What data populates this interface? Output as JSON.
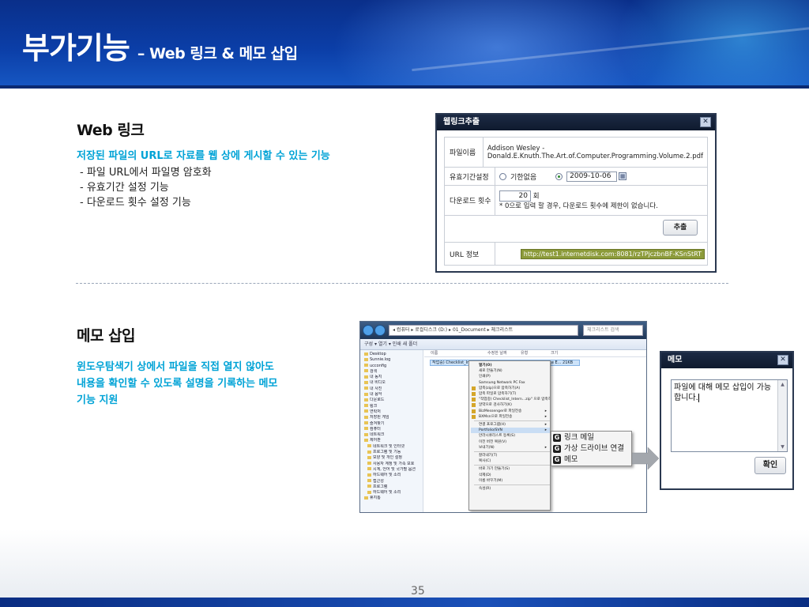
{
  "header": {
    "title_big": "부가기능",
    "title_sub": "– Web 링크 & 메모 삽입"
  },
  "web_link": {
    "title": "Web 링크",
    "lead": "저장된 파일의 URL로 자료를 웹 상에 게시할 수 있는 기능",
    "items": [
      "- 파일 URL에서 파일명 암호화",
      "- 유효기간 설정 기능",
      "- 다운로드 횟수 설정 기능"
    ]
  },
  "web_dialog": {
    "title": "웹링크추출",
    "close": "✕",
    "filename_label": "파일이름",
    "filename_value_1": "Addison Wesley -",
    "filename_value_2": "Donald.E.Knuth.The.Art.of.Computer.Programming.Volume.2.pdf",
    "expiry_label": "유효기간설정",
    "expiry_option_none": "기한없음",
    "expiry_date": "2009-10-06",
    "download_label": "다운로드 횟수",
    "download_count": "20",
    "download_unit": "회",
    "download_note": "* 0으로 입력 할 경우, 다운로드 횟수에 제한이 없습니다.",
    "extract_button": "추출",
    "url_label": "URL 정보",
    "url_value": "http://test1.internetdisk.com:8081/rzTPjczbnBF-KSnStRT"
  },
  "memo_section": {
    "title": "메모 삽입",
    "lead_lines": [
      "윈도우탐색기 상에서 파일을 직접 열지 않아도",
      "내용을 확인할 수 있도록 설명을 기록하는 메모",
      "기능 지원"
    ]
  },
  "explorer": {
    "address": "◂ 컴퓨터 ▸ 로컬디스크 (D:) ▸ 01_Document ▸ 체크리스트",
    "search": "체크리스트 검색",
    "toolbar": "구성 ▾    열기 ▾    인쇄    새 폴더",
    "columns": [
      "이름",
      "수정한 날짜",
      "유형",
      "크기"
    ],
    "file": "작업중) Checklist_Internet...  2010-01-05 오후...  Microsoft Office E...  21KB",
    "sidebar": [
      "Desktop",
      "Sunnie.log",
      "ucconfig",
      "검색",
      "내 동지",
      "내 비디오",
      "내 사진",
      "내 음악",
      "다운로드",
      "링크",
      "연락처",
      "저장된 게임",
      "즐겨찾기",
      "컴퓨터",
      "네트워크",
      "제어판",
      "네트워크 및 인터넷",
      "프로그램 및 기능",
      "모양 및 개인 설정",
      "사용자 계정 및 가족 보호",
      "시계, 언어 및 국가별 옵션",
      "하드웨어 및 소리",
      "접근성",
      "프로그램",
      "하드웨어 및 소리",
      "휴지통"
    ],
    "context_menu": [
      "열기(O)",
      "새로 만들기(N)",
      "인쇄(P)",
      "Samsung Network PC Fax",
      "압축(zip)으로 압축하기(A)",
      "압축 파일로 압축하기(T)",
      "\"작업중) Checklist_Intern...zip\" 으로 압축하기(Q)",
      "알약으로 검사하기(K)",
      "BizMessenger로 파일전송",
      "BXMsn으로 파일전송",
      "연결 프로그램(H)",
      "Portfolio/SVN",
      "이전 버전 복원(V)",
      "보내기(N)",
      "잘라내기(T)",
      "복사(C)",
      "바로 가기 만들기(S)",
      "삭제(D)",
      "이름 바꾸기(M)",
      "속성(R)"
    ],
    "security_item": "안라시큐리스트 등록(S)"
  },
  "submenu": {
    "items": [
      "링크 메일",
      "가상 드라이브 연결",
      "메모"
    ]
  },
  "memo_dialog": {
    "title": "메모",
    "close": "✕",
    "text_line1": "파일에 대해 메모 삽입이 가능",
    "text_line2": "합니다.",
    "ok_button": "확인"
  },
  "footer": {
    "page_number": "35"
  },
  "colors": {
    "header": "#0b3ea7",
    "lead_text": "#00a3d6",
    "dialog_title": "#1c2a44"
  }
}
